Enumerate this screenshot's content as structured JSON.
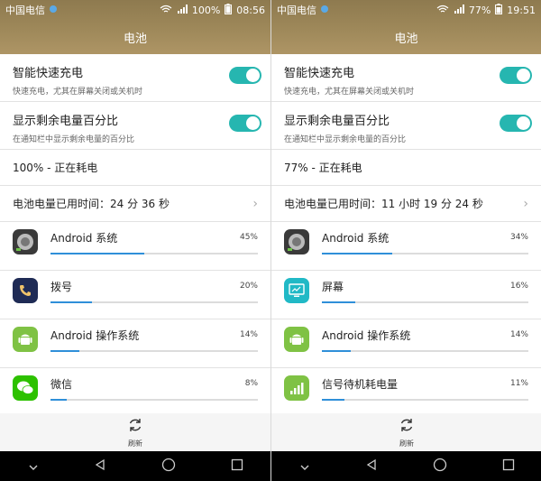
{
  "colors": {
    "accent": "#26b6b0",
    "header": "#a08a5b",
    "bar": "#2f8fd9"
  },
  "left": {
    "status": {
      "carrier": "中国电信",
      "battery": "100%",
      "time": "08:56"
    },
    "title": "电池",
    "smart_charge": {
      "label": "智能快速充电",
      "desc": "快速充电，尤其在屏幕关闭或关机时",
      "on": true
    },
    "show_percent": {
      "label": "显示剩余电量百分比",
      "desc": "在通知栏中显示剩余电量的百分比",
      "on": true
    },
    "battery_state": "100% - 正在耗电",
    "usage_time": "电池电量已用时间：24 分 36 秒",
    "apps": [
      {
        "name": "Android 系统",
        "percent": "45%",
        "icon": "android-system-icon"
      },
      {
        "name": "拨号",
        "percent": "20%",
        "icon": "phone-dialer-icon"
      },
      {
        "name": "Android 操作系统",
        "percent": "14%",
        "icon": "android-os-icon"
      },
      {
        "name": "微信",
        "percent": "8%",
        "icon": "wechat-icon"
      }
    ],
    "refresh_label": "刷新"
  },
  "right": {
    "status": {
      "carrier": "中国电信",
      "battery": "77%",
      "time": "19:51"
    },
    "title": "电池",
    "smart_charge": {
      "label": "智能快速充电",
      "desc": "快速充电，尤其在屏幕关闭或关机时",
      "on": true
    },
    "show_percent": {
      "label": "显示剩余电量百分比",
      "desc": "在通知栏中显示剩余电量的百分比",
      "on": true
    },
    "battery_state": "77% - 正在耗电",
    "usage_time": "电池电量已用时间：11 小时 19 分 24 秒",
    "apps": [
      {
        "name": "Android 系统",
        "percent": "34%",
        "icon": "android-system-icon"
      },
      {
        "name": "屏幕",
        "percent": "16%",
        "icon": "screen-icon"
      },
      {
        "name": "Android 操作系统",
        "percent": "14%",
        "icon": "android-os-icon"
      },
      {
        "name": "信号待机耗电量",
        "percent": "11%",
        "icon": "signal-standby-icon"
      }
    ],
    "refresh_label": "刷新"
  }
}
